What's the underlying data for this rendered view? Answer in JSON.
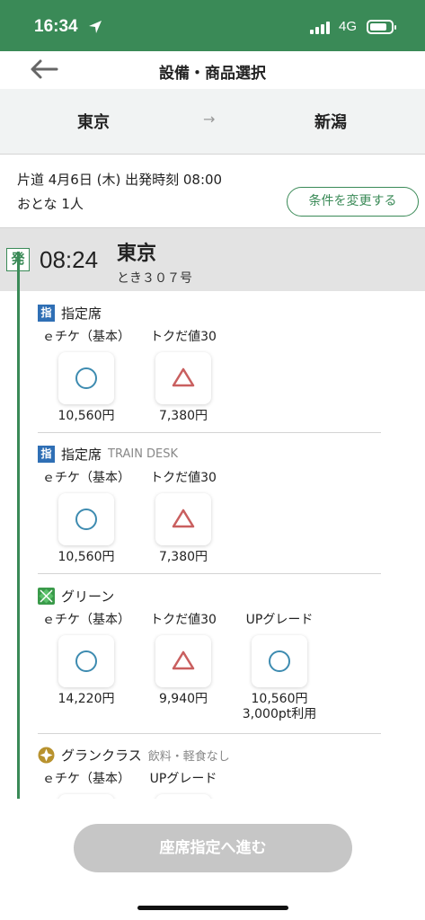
{
  "status_bar": {
    "time": "16:34",
    "network": "4G"
  },
  "nav": {
    "title": "設備・商品選択"
  },
  "route": {
    "from": "東京",
    "arrow": "→",
    "to": "新潟"
  },
  "conditions": {
    "line1": "片道 4月6日 (木) 出発時刻 08:00",
    "line2": "おとな 1人",
    "change_button": "条件を変更する"
  },
  "train": {
    "badge": "発",
    "departure_time": "08:24",
    "station": "東京",
    "name": "とき３０７号"
  },
  "sections": [
    {
      "icon": "reserved-seat-icon",
      "icon_text": "指",
      "title": "指定席",
      "subtitle": "",
      "options": [
        {
          "label": "ｅチケ（基本）",
          "availability": "available",
          "price": "10,560円",
          "extra": ""
        },
        {
          "label": "トクだ値30",
          "availability": "few-left",
          "price": "7,380円",
          "extra": ""
        }
      ]
    },
    {
      "icon": "reserved-seat-icon",
      "icon_text": "指",
      "title": "指定席",
      "subtitle": "TRAIN DESK",
      "options": [
        {
          "label": "ｅチケ（基本）",
          "availability": "available",
          "price": "10,560円",
          "extra": ""
        },
        {
          "label": "トクだ値30",
          "availability": "few-left",
          "price": "7,380円",
          "extra": ""
        }
      ]
    },
    {
      "icon": "green-car-icon",
      "icon_text": "",
      "title": "グリーン",
      "subtitle": "",
      "options": [
        {
          "label": "ｅチケ（基本）",
          "availability": "available",
          "price": "14,220円",
          "extra": ""
        },
        {
          "label": "トクだ値30",
          "availability": "few-left",
          "price": "9,940円",
          "extra": ""
        },
        {
          "label": "UPグレード",
          "availability": "available",
          "price": "10,560円",
          "extra": "3,000pt利用"
        }
      ]
    },
    {
      "icon": "gran-class-icon",
      "icon_text": "",
      "title": "グランクラス",
      "subtitle": "飲料・軽食なし",
      "options": [
        {
          "label": "ｅチケ（基本）",
          "availability": "",
          "price": "",
          "extra": ""
        },
        {
          "label": "UPグレード",
          "availability": "",
          "price": "",
          "extra": ""
        }
      ]
    }
  ],
  "footer": {
    "proceed_button": "座席指定へ進む"
  },
  "colors": {
    "brand_green": "#3a8a57",
    "available": "#3d8bb0",
    "few_left": "#c95f5f",
    "reserved_blue": "#2f6fb5",
    "disabled_button": "#c6c6c6"
  }
}
